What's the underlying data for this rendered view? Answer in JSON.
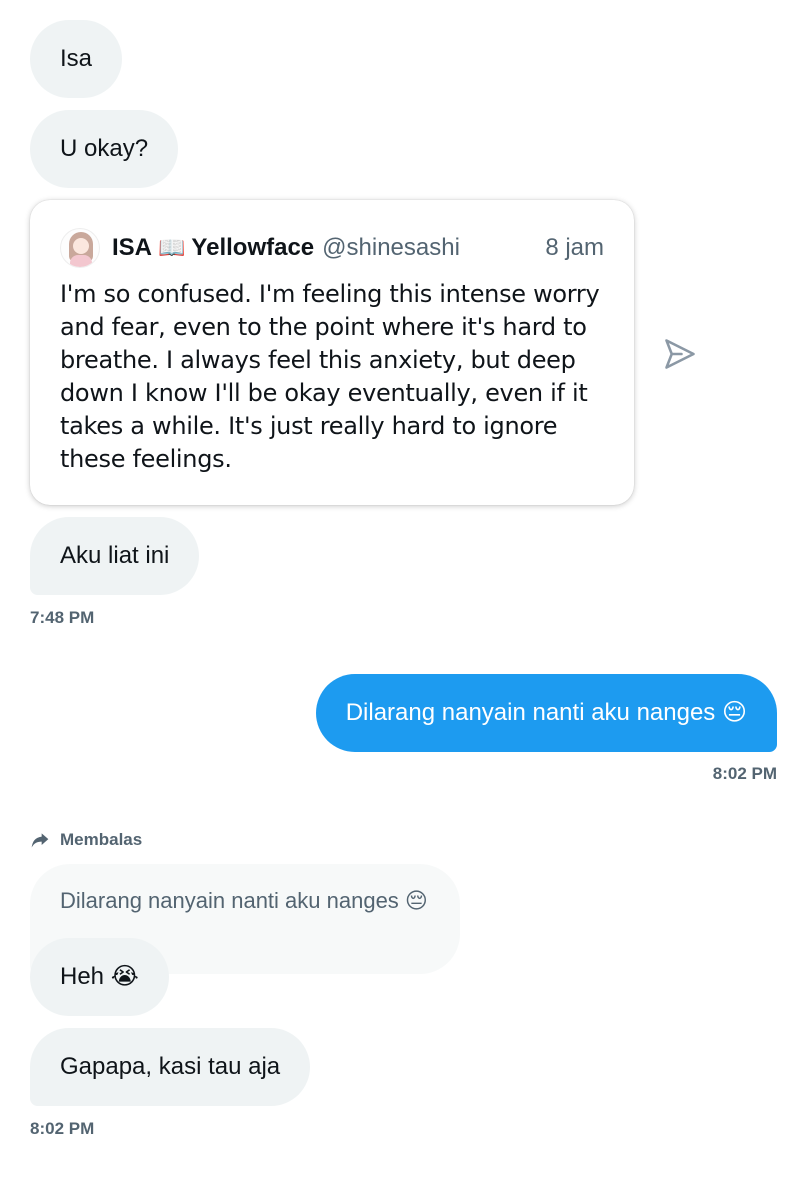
{
  "messages": {
    "m1": "Isa",
    "m2": "U okay?",
    "m3": "Aku liat ini",
    "time1": "7:48 PM",
    "out1": "Dilarang nanyain nanti aku nanges 😔",
    "time2": "8:02 PM",
    "reply_label": "Membalas",
    "replied_text": "Dilarang nanyain nanti aku nanges 😔",
    "m4": "Heh 😭",
    "m5": "Gapapa, kasi tau aja",
    "time3": "8:02 PM"
  },
  "quote": {
    "name": "ISA",
    "name_emoji": "📖",
    "name_suffix": "Yellowface",
    "handle": "@shinesashi",
    "time": "8 jam",
    "text": "I'm so confused. I'm feeling this intense worry and fear, even to the point where it's hard to breathe. I always feel this anxiety, but deep down I know I'll be okay eventually, even if it takes a while. It's just really hard to ignore these feelings."
  },
  "icons": {
    "share": "share-icon",
    "reply": "reply-arrow-icon"
  },
  "colors": {
    "incoming_bg": "#eff3f4",
    "outgoing_bg": "#1d9bf0",
    "secondary_text": "#536471"
  }
}
